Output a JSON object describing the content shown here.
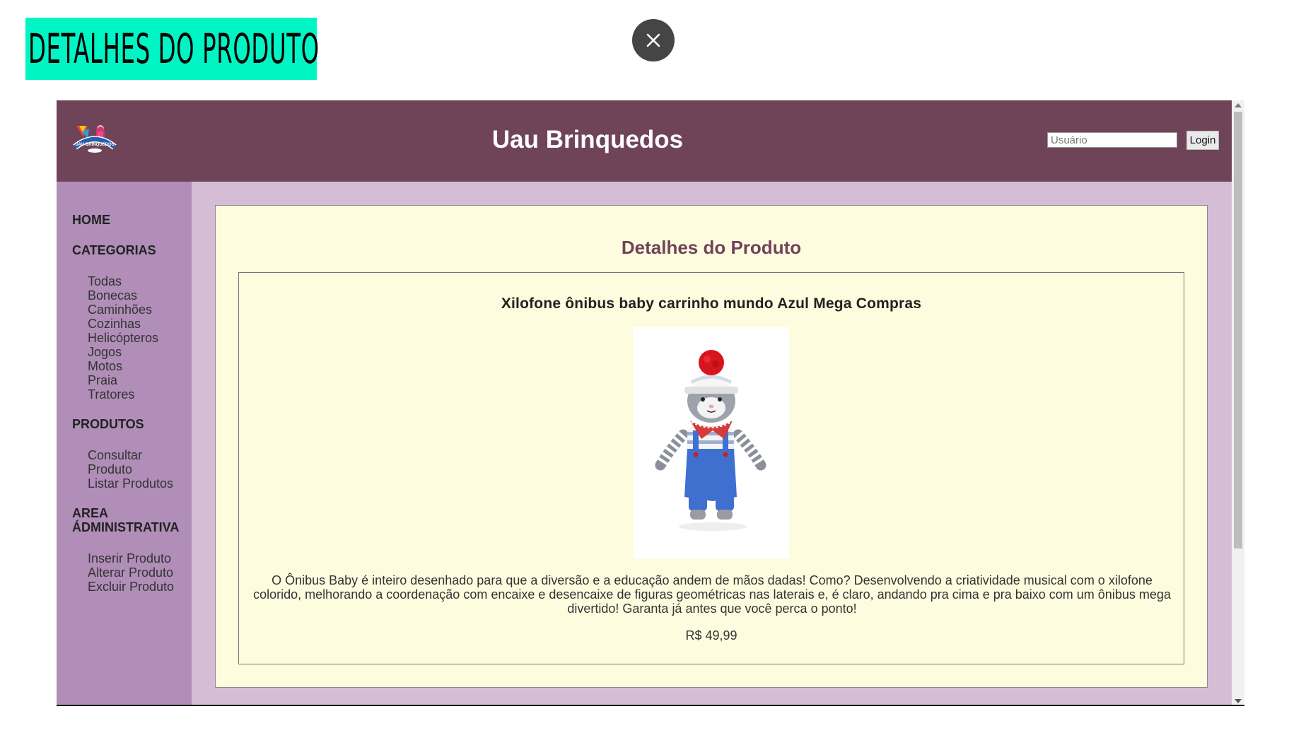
{
  "slide": {
    "banner_title": "DETALHES DO PRODUTO",
    "close_icon": "close-icon"
  },
  "site": {
    "title": "Uau Brinquedos",
    "logo_text": "UAU BRINQUEDOS",
    "login": {
      "placeholder": "Usuário",
      "button_label": "Login"
    }
  },
  "sidebar": {
    "home": "HOME",
    "categorias_title": "CATEGORIAS",
    "categorias": [
      "Todas",
      "Bonecas",
      "Caminhões",
      "Cozinhas",
      "Helicópteros",
      "Jogos",
      "Motos",
      "Praia",
      "Tratores"
    ],
    "produtos_title": "PRODUTOS",
    "produtos": [
      "Consultar Produto",
      "Listar Produtos"
    ],
    "admin_title": "AREA ÁDMINISTRATIVA",
    "admin": [
      "Inserir Produto",
      "Alterar Produto",
      "Excluir Produto"
    ]
  },
  "main": {
    "title": "Detalhes do Produto",
    "product": {
      "name": "Xilofone ônibus baby carrinho mundo Azul Mega Compras",
      "image": "crochet-cat-doll",
      "description": "O Ônibus Baby é inteiro desenhado para que a diversão e a educação andem de mãos dadas! Como? Desenvolvendo a criatividade musical com o xilofone colorido, melhorando a coordenação com encaixe e desencaixe de figuras geométricas nas laterais e, é claro, andando pra cima e pra baixo com um ônibus mega divertido! Garanta já antes que você perca o ponto!",
      "price": "R$ 49,99"
    }
  },
  "colors": {
    "banner": "#00f5c4",
    "header": "#6f4458",
    "sidebar": "#b08eb8",
    "page_bg": "#d6bdd6",
    "content_bg": "#fefcdf"
  }
}
